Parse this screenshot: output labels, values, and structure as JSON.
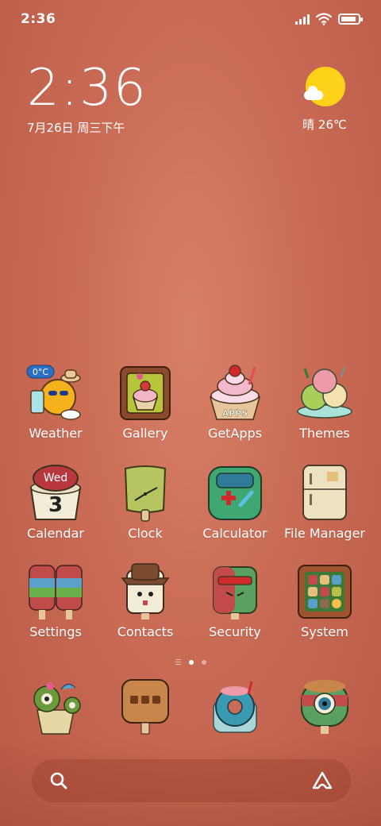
{
  "status_bar": {
    "time": "2:36",
    "battery_level": 0.9,
    "icons": [
      "signal-icon",
      "wifi-icon",
      "battery-icon"
    ]
  },
  "clock_widget": {
    "time": "2:36",
    "date": "7月26日 周三下午"
  },
  "weather_widget": {
    "condition_icon": "sun-cloud-icon",
    "text": "晴 26℃"
  },
  "apps_row1": [
    {
      "label": "Weather",
      "icon": "weather-icon",
      "badge": "0°C"
    },
    {
      "label": "Gallery",
      "icon": "gallery-icon"
    },
    {
      "label": "GetApps",
      "icon": "getapps-icon",
      "badge": "APPS"
    },
    {
      "label": "Themes",
      "icon": "themes-icon"
    }
  ],
  "apps_row2": [
    {
      "label": "Calendar",
      "icon": "calendar-icon",
      "day_name": "Wed",
      "day_number": "3"
    },
    {
      "label": "Clock",
      "icon": "clock-icon"
    },
    {
      "label": "Calculator",
      "icon": "calculator-icon"
    },
    {
      "label": "File Manager",
      "icon": "file-manager-icon"
    }
  ],
  "apps_row3": [
    {
      "label": "Settings",
      "icon": "settings-icon"
    },
    {
      "label": "Contacts",
      "icon": "contacts-icon"
    },
    {
      "label": "Security",
      "icon": "security-icon"
    },
    {
      "label": "System",
      "icon": "system-icon"
    }
  ],
  "page_indicator": {
    "pages": 2,
    "current": 1
  },
  "dock": [
    {
      "icon": "dock-app-1-icon"
    },
    {
      "icon": "messages-icon"
    },
    {
      "icon": "browser-icon"
    },
    {
      "icon": "camera-icon"
    }
  ],
  "search_bar": {
    "left_icon": "search-icon",
    "right_icon": "assistant-icon"
  },
  "colors": {
    "background": "#c96b55",
    "sun": "#ffd21a",
    "text": "#ffffff"
  }
}
